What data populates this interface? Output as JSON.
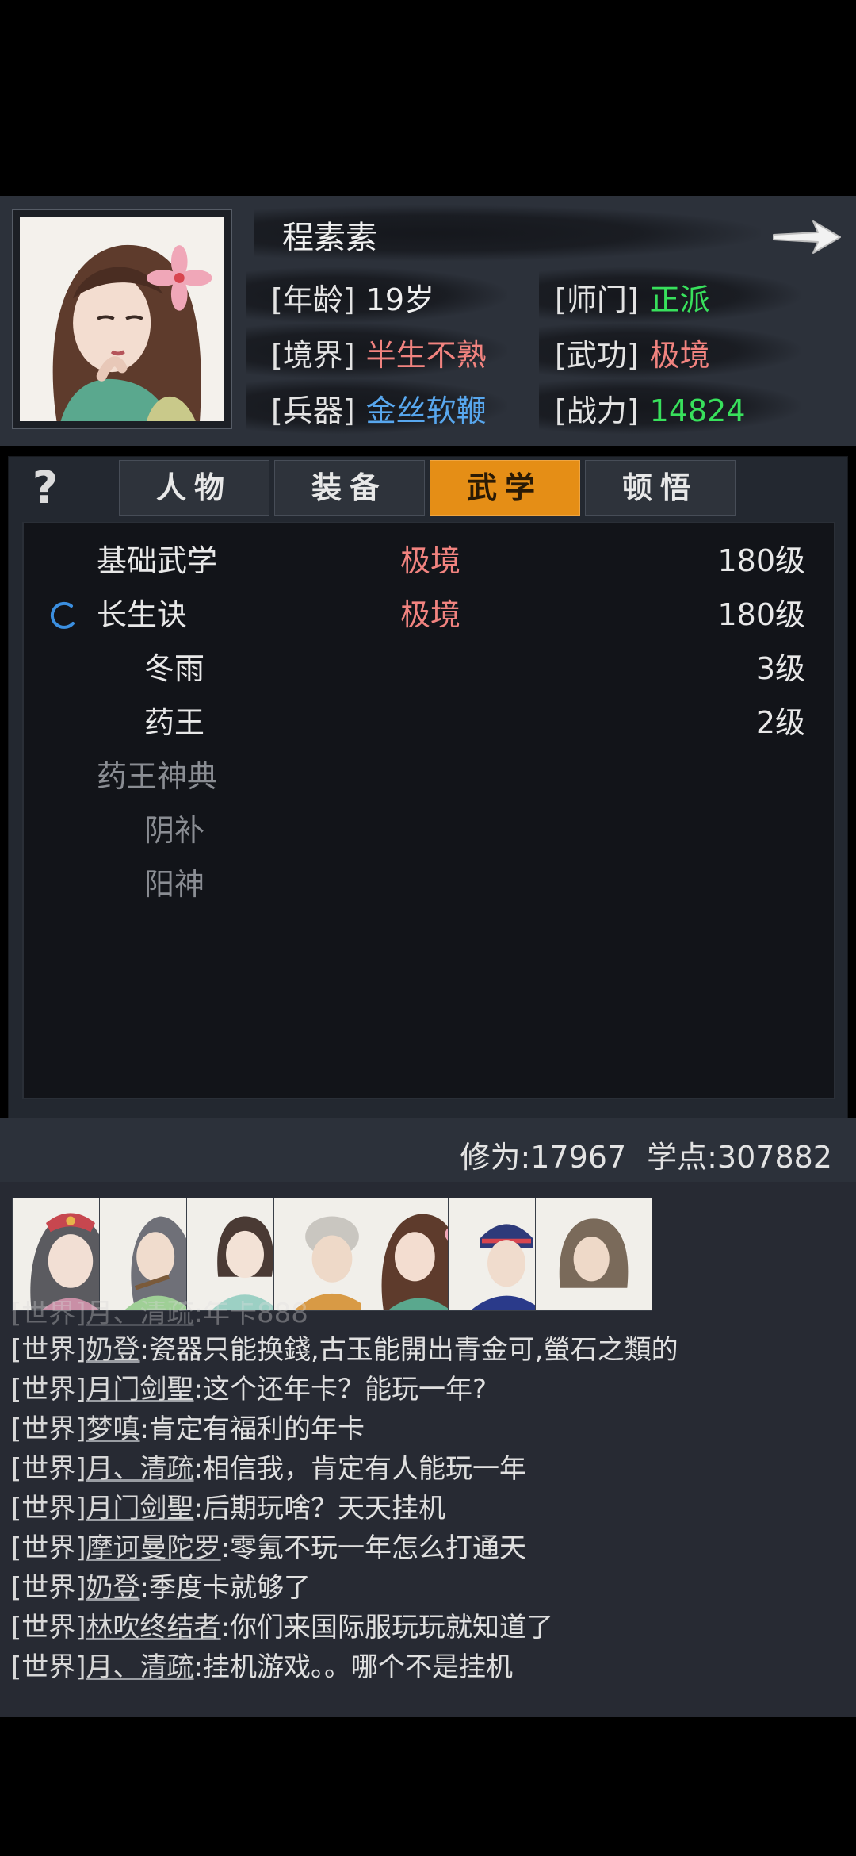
{
  "character": {
    "name": "程素素",
    "attributes": [
      {
        "label": "[年龄]",
        "value": "19岁",
        "color": "#efefef"
      },
      {
        "label": "[师门]",
        "value": "正派",
        "color": "#38e05c"
      },
      {
        "label": "[境界]",
        "value": "半生不熟",
        "color": "#f1837f"
      },
      {
        "label": "[武功]",
        "value": "极境",
        "color": "#f1837f"
      },
      {
        "label": "[兵器]",
        "value": "金丝软鞭",
        "color": "#58a7ee"
      },
      {
        "label": "[战力]",
        "value": "14824",
        "color": "#38e05c"
      }
    ],
    "next_icon": "arrow-right-icon"
  },
  "help_label": "?",
  "tabs": [
    {
      "label": "人物",
      "active": false
    },
    {
      "label": "装备",
      "active": false
    },
    {
      "label": "武学",
      "active": true
    },
    {
      "label": "顿悟",
      "active": false
    }
  ],
  "skills": [
    {
      "name": "基础武学",
      "realm": "极境",
      "level": "180级",
      "indent": 0,
      "dim": false,
      "icon": ""
    },
    {
      "name": "长生诀",
      "realm": "极境",
      "level": "180级",
      "indent": 0,
      "dim": false,
      "icon": "loading-spinner-icon"
    },
    {
      "name": "冬雨",
      "realm": "",
      "level": "3级",
      "indent": 1,
      "dim": false,
      "icon": ""
    },
    {
      "name": "药王",
      "realm": "",
      "level": "2级",
      "indent": 1,
      "dim": false,
      "icon": ""
    },
    {
      "name": "药王神典",
      "realm": "",
      "level": "",
      "indent": 0,
      "dim": true,
      "icon": ""
    },
    {
      "name": "阴补",
      "realm": "",
      "level": "",
      "indent": 1,
      "dim": true,
      "icon": ""
    },
    {
      "name": "阳神",
      "realm": "",
      "level": "",
      "indent": 1,
      "dim": true,
      "icon": ""
    }
  ],
  "stats": {
    "cultivation": "修为:17967",
    "learning_points": "学点:307882"
  },
  "chat": {
    "avatars": [
      "npc-avatar-1",
      "npc-avatar-2",
      "npc-avatar-3",
      "npc-avatar-4",
      "npc-avatar-5",
      "npc-avatar-6",
      "npc-avatar-7"
    ],
    "messages": [
      {
        "channel": "[世界]",
        "user": "月、清疏",
        "text": ":年卡888",
        "ghost": true
      },
      {
        "channel": "[世界]",
        "user": "奶登",
        "text": ":瓷器只能换錢,古玉能開出青金可,螢石之類的",
        "ghost": false
      },
      {
        "channel": "[世界]",
        "user": "月门剑聖",
        "text": ":这个还年卡？能玩一年?",
        "ghost": false
      },
      {
        "channel": "[世界]",
        "user": "梦嗔",
        "text": ":肯定有福利的年卡",
        "ghost": false
      },
      {
        "channel": "[世界]",
        "user": "月、清疏",
        "text": ":相信我，肯定有人能玩一年",
        "ghost": false
      },
      {
        "channel": "[世界]",
        "user": "月门剑聖",
        "text": ":后期玩啥？天天挂机",
        "ghost": false
      },
      {
        "channel": "[世界]",
        "user": "摩诃曼陀罗",
        "text": ":零氪不玩一年怎么打通天",
        "ghost": false
      },
      {
        "channel": "[世界]",
        "user": "奶登",
        "text": ":季度卡就够了",
        "ghost": false
      },
      {
        "channel": "[世界]",
        "user": "林吹终结者",
        "text": ":你们来国际服玩玩就知道了",
        "ghost": false
      },
      {
        "channel": "[世界]",
        "user": "月、清疏",
        "text": ":挂机游戏。。哪个不是挂机",
        "ghost": false
      }
    ]
  }
}
